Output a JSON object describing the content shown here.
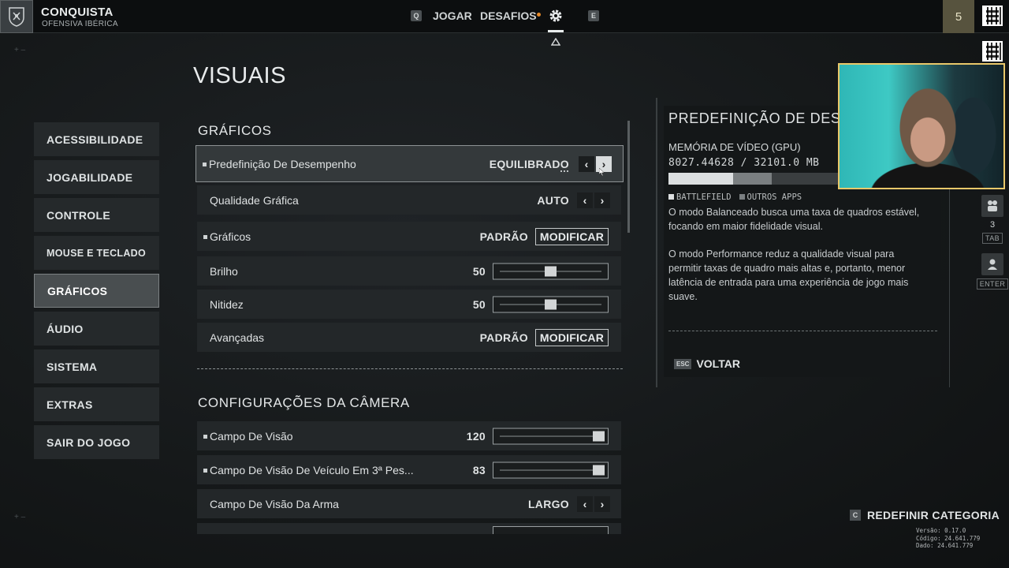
{
  "header": {
    "mode_title": "CONQUISTA",
    "mode_subtitle": "OFENSIVA IBÉRICA",
    "nav": {
      "key_left": "Q",
      "play": "JOGAR",
      "challenges": "DESAFIOS",
      "settings_icon": "gear-icon",
      "key_right": "E"
    },
    "level": "5"
  },
  "page_title": "VISUAIS",
  "sidebar": {
    "items": [
      {
        "label": "ACESSIBILIDADE",
        "active": false
      },
      {
        "label": "JOGABILIDADE",
        "active": false
      },
      {
        "label": "CONTROLE",
        "active": false
      },
      {
        "label": "MOUSE E TECLADO",
        "active": false
      },
      {
        "label": "GRÁFICOS",
        "active": true
      },
      {
        "label": "ÁUDIO",
        "active": false
      },
      {
        "label": "SISTEMA",
        "active": false
      },
      {
        "label": "EXTRAS",
        "active": false
      },
      {
        "label": "SAIR DO JOGO",
        "active": false
      }
    ]
  },
  "graphics_section": {
    "title": "GRÁFICOS",
    "rows": [
      {
        "label": "Predefinição De Desempenho",
        "value": "EQUILIBRADO",
        "control": "arrows"
      },
      {
        "label": "Qualidade Gráfica",
        "value": "AUTO",
        "control": "arrows"
      },
      {
        "label": "Gráficos",
        "value": "PADRÃO",
        "control": "button",
        "button_label": "MODIFICAR"
      },
      {
        "label": "Brilho",
        "value": "50",
        "control": "slider",
        "level": 0.5
      },
      {
        "label": "Nitidez",
        "value": "50",
        "control": "slider",
        "level": 0.5
      },
      {
        "label": "Avançadas",
        "value": "PADRÃO",
        "control": "button",
        "button_label": "MODIFICAR"
      }
    ]
  },
  "camera_section": {
    "title": "CONFIGURAÇÕES DA CÂMERA",
    "rows": [
      {
        "label": "Campo De Visão",
        "value": "120",
        "control": "slider",
        "level": 1.0
      },
      {
        "label": "Campo De Visão De Veículo Em 3ª Pes...",
        "value": "83",
        "control": "slider",
        "level": 1.0
      },
      {
        "label": "Campo De Visão Da Arma",
        "value": "LARGO",
        "control": "arrows"
      }
    ]
  },
  "info_panel": {
    "title": "PREDEFINIÇÃO DE DESEMPENHO",
    "vram_label": "MEMÓRIA DE VÍDEO (GPU)",
    "vram_values": "8027.44628 / 32101.0 MB",
    "vram_usage": {
      "battlefield": 0.25,
      "other_apps": 0.15
    },
    "legend": {
      "battlefield": "BATTLEFIELD",
      "other_apps": "OUTROS APPS"
    },
    "description_1": "O modo Balanceado busca uma taxa de quadros estável, focando em maior fidelidade visual.",
    "description_2": "O modo Performance reduz a qualidade visual para permitir taxas de quadro mais altas e, portanto, menor latência de entrada para uma experiência de jogo mais suave.",
    "back_key": "ESC",
    "back_label": "VOLTAR"
  },
  "right_rail": {
    "squad_count": "3",
    "tab_key": "TAB",
    "enter_key": "ENTER"
  },
  "footer": {
    "reset_key": "C",
    "reset_label": "REDEFINIR CATEGORIA",
    "version": "Versão: 0.17.0",
    "code": "Código: 24.641.779",
    "data": "Dado: 24.641.779"
  },
  "colors": {
    "accent_orange": "#e5892a",
    "webcam_border": "#e9c86a",
    "panel_bg": "#141718",
    "row_bg": "#232729"
  }
}
